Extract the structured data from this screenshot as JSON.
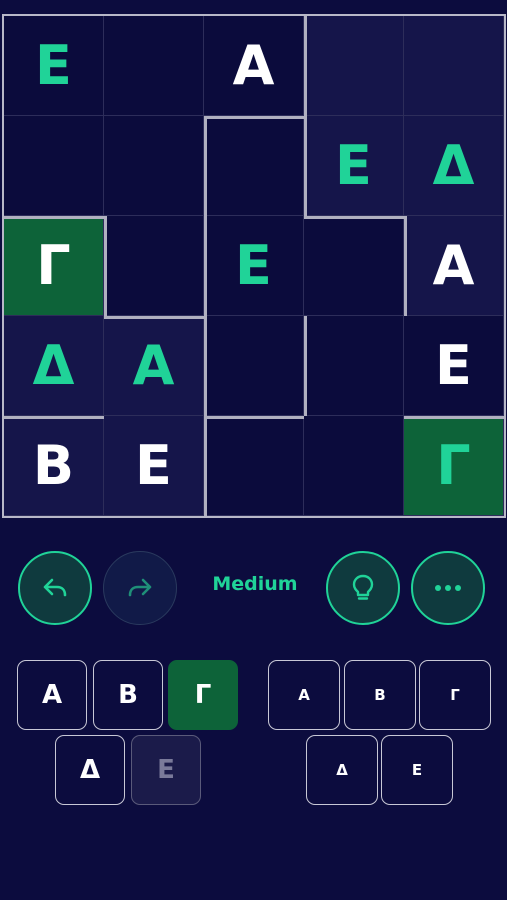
{
  "board": {
    "rows": [
      [
        {
          "v": "E",
          "c": "green",
          "bg": "dark"
        },
        {
          "v": "",
          "c": "",
          "bg": "dark"
        },
        {
          "v": "A",
          "c": "white",
          "bg": "dark"
        },
        {
          "v": "",
          "c": "",
          "bg": "mid"
        },
        {
          "v": "",
          "c": "",
          "bg": "mid"
        }
      ],
      [
        {
          "v": "",
          "c": "",
          "bg": "dark"
        },
        {
          "v": "",
          "c": "",
          "bg": "dark"
        },
        {
          "v": "",
          "c": "",
          "bg": "dark"
        },
        {
          "v": "E",
          "c": "green",
          "bg": "mid"
        },
        {
          "v": "Δ",
          "c": "green",
          "bg": "mid"
        }
      ],
      [
        {
          "v": "Γ",
          "c": "white",
          "bg": "sel"
        },
        {
          "v": "",
          "c": "",
          "bg": "dark"
        },
        {
          "v": "E",
          "c": "green",
          "bg": "dark"
        },
        {
          "v": "",
          "c": "",
          "bg": "dark"
        },
        {
          "v": "A",
          "c": "white",
          "bg": "mid"
        }
      ],
      [
        {
          "v": "Δ",
          "c": "green",
          "bg": "mid"
        },
        {
          "v": "A",
          "c": "green",
          "bg": "mid"
        },
        {
          "v": "",
          "c": "",
          "bg": "dark"
        },
        {
          "v": "",
          "c": "",
          "bg": "dark"
        },
        {
          "v": "E",
          "c": "white",
          "bg": "dark"
        }
      ],
      [
        {
          "v": "B",
          "c": "white",
          "bg": "mid"
        },
        {
          "v": "E",
          "c": "white",
          "bg": "mid"
        },
        {
          "v": "",
          "c": "",
          "bg": "dark"
        },
        {
          "v": "",
          "c": "",
          "bg": "dark"
        },
        {
          "v": "Γ",
          "c": "green",
          "bg": "sel"
        }
      ]
    ]
  },
  "controls": {
    "difficulty": "Medium",
    "undo_icon": "undo-arrow-icon",
    "redo_icon": "redo-arrow-icon",
    "hint_icon": "lightbulb-icon",
    "more_icon": "ellipsis-icon",
    "accent": "#20d398",
    "selected_color": "#0d6339"
  },
  "keypad_left": [
    {
      "label": "A",
      "state": "normal"
    },
    {
      "label": "B",
      "state": "normal"
    },
    {
      "label": "Γ",
      "state": "active"
    },
    {
      "label": "Δ",
      "state": "normal"
    },
    {
      "label": "E",
      "state": "used"
    }
  ],
  "keypad_right": [
    {
      "label": "A"
    },
    {
      "label": "B"
    },
    {
      "label": "Γ"
    },
    {
      "label": "Δ"
    },
    {
      "label": "E"
    }
  ]
}
